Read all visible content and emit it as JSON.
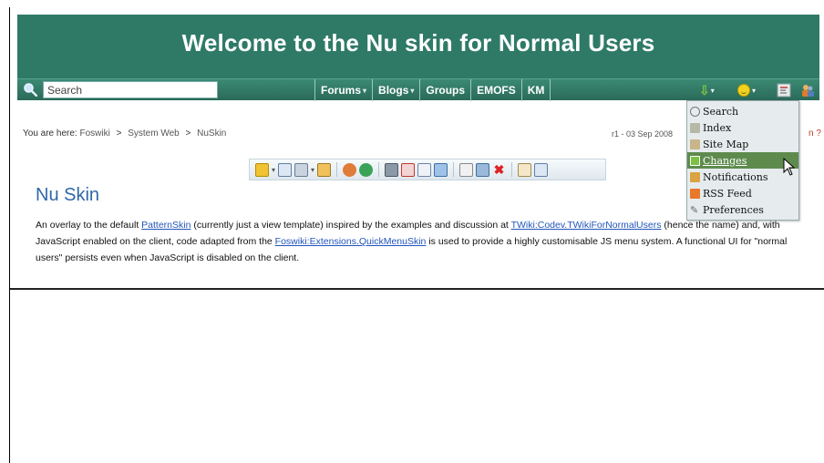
{
  "banner": {
    "title": "Welcome to the Nu skin for Normal Users",
    "color": "#2f7a66"
  },
  "navbar": {
    "search_placeholder": "Search",
    "menu": [
      {
        "label": "Forums",
        "has_caret": true
      },
      {
        "label": "Blogs",
        "has_caret": true
      },
      {
        "label": "Groups",
        "has_caret": false
      },
      {
        "label": "EMOFS",
        "has_caret": false
      },
      {
        "label": "KM",
        "has_caret": false
      }
    ],
    "icons": [
      "changes-arrow-icon",
      "smiley-icon",
      "rss-icon",
      "users-icon"
    ]
  },
  "breadcrumb": {
    "prefix": "You are here:",
    "items": [
      "Foswiki",
      "System Web",
      "NuSkin"
    ],
    "separator": ">"
  },
  "revision_info": "r1 - 03 Sep 2008",
  "help_fragment": "n ?",
  "topic": {
    "title": "Nu Skin",
    "para_1": "An overlay to the default ",
    "link_1": "PatternSkin",
    "para_2": " (currently just a view template) inspired by the examples and discussion at ",
    "link_2": "TWiki:Codev.TWikiForNormalUsers",
    "para_3": " (hence the name) and, with JavaScript enabled on the client, code adapted from the ",
    "link_3": "Foswiki:Extensions.QuickMenuSkin",
    "para_4": " is used to provide a highly customisable JS menu system. A functional UI for \"normal users\" persists even when JavaScript is disabled on the client."
  },
  "dropdown": {
    "items": [
      {
        "label": "Search",
        "icon": "search-icon",
        "color": "#777777"
      },
      {
        "label": "Index",
        "icon": "index-icon",
        "color": "#b8b8a8"
      },
      {
        "label": "Site Map",
        "icon": "sitemap-icon",
        "color": "#c8b58a"
      },
      {
        "label": "Changes",
        "icon": "changes-icon",
        "color": "#7cc144",
        "active": true
      },
      {
        "label": "Notifications",
        "icon": "notifications-icon",
        "color": "#d9a441"
      },
      {
        "label": "RSS Feed",
        "icon": "rss-icon",
        "color": "#e8782a"
      },
      {
        "label": "Preferences",
        "icon": "preferences-icon",
        "color": "#666666"
      }
    ]
  }
}
